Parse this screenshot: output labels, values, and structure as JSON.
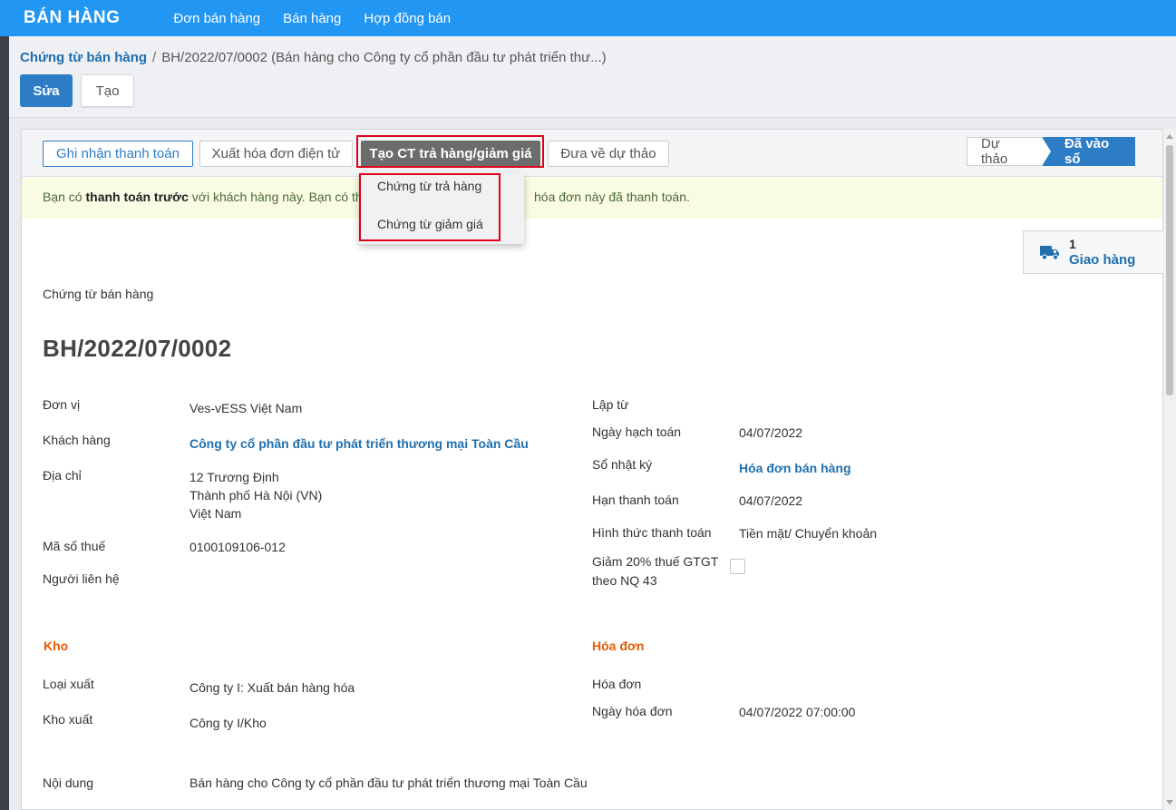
{
  "app": {
    "title": "BÁN HÀNG"
  },
  "topnav": [
    "Đơn bán hàng",
    "Bán hàng",
    "Hợp đồng bán"
  ],
  "breadcrumb": {
    "parent": "Chứng từ bán hàng",
    "separator": "/",
    "current": "BH/2022/07/0002 (Bán hàng cho Công ty cổ phần đầu tư phát triển thư...)"
  },
  "toolbar": {
    "edit_label": "Sửa",
    "create_label": "Tạo"
  },
  "statusbar": {
    "record_payment": "Ghi nhận thanh toán",
    "issue_einvoice": "Xuất hóa đơn điện tử",
    "create_return": "Tạo CT trả hàng/giảm giá",
    "reset_draft": "Đưa về dự thảo",
    "stages": {
      "draft": "Dự thảo",
      "posted": "Đã vào sổ"
    }
  },
  "dropdown": {
    "items": [
      "Chứng từ trả hàng",
      "Chứng từ giảm giá"
    ]
  },
  "alert": {
    "part1": "Bạn có ",
    "bold": "thanh toán trước",
    "part2": " với khách hàng này. Bạn có thể",
    "part3": "hóa đơn này đã thanh toán."
  },
  "smart_button": {
    "count": "1",
    "label": "Giao hàng",
    "icon": "truck-icon"
  },
  "form": {
    "doc_type": "Chứng từ bán hàng",
    "name": "BH/2022/07/0002",
    "left": {
      "unit_label": "Đơn vị",
      "unit_value": "Ves-vESS Việt Nam",
      "customer_label": "Khách hàng",
      "customer_value": "Công ty cổ phần đầu tư phát triển thương mại Toàn Cầu",
      "address_label": "Địa chỉ",
      "address_line1": "12 Trương Định",
      "address_line2": "Thành phố Hà Nội (VN)",
      "address_line3": "Việt Nam",
      "tax_label": "Mã số thuế",
      "tax_value": "0100109106-012",
      "contact_label": "Người liên hệ"
    },
    "right": {
      "created_from_label": "Lập từ",
      "accounting_date_label": "Ngày hạch toán",
      "accounting_date_value": "04/07/2022",
      "journal_label": "Sổ nhật ký",
      "journal_value": "Hóa đơn bán hàng",
      "due_date_label": "Hạn thanh toán",
      "due_date_value": "04/07/2022",
      "payment_method_label": "Hình thức thanh toán",
      "payment_method_value": "Tiền mặt/ Chuyển khoản",
      "vat_reduction_label_1": "Giảm 20% thuế GTGT",
      "vat_reduction_label_2": "theo NQ 43"
    },
    "warehouse": {
      "title": "Kho",
      "export_type_label": "Loại xuất",
      "export_type_value": "Công ty I: Xuất bán hàng hóa",
      "warehouse_label": "Kho xuất",
      "warehouse_value": "Công ty I/Kho"
    },
    "invoice": {
      "title": "Hóa đơn",
      "invoice_label": "Hóa đơn",
      "invoice_date_label": "Ngày hóa đơn",
      "invoice_date_value": "04/07/2022 07:00:00"
    },
    "content_label": "Nội dung",
    "content_value": "Bán hàng cho Công ty cổ phần đầu tư phát triển thương mại Toàn Cầu"
  },
  "colors": {
    "topbar": "#2196f3",
    "primary": "#2d7cc6",
    "section": "#e65b00",
    "highlight": "#e0001b"
  }
}
